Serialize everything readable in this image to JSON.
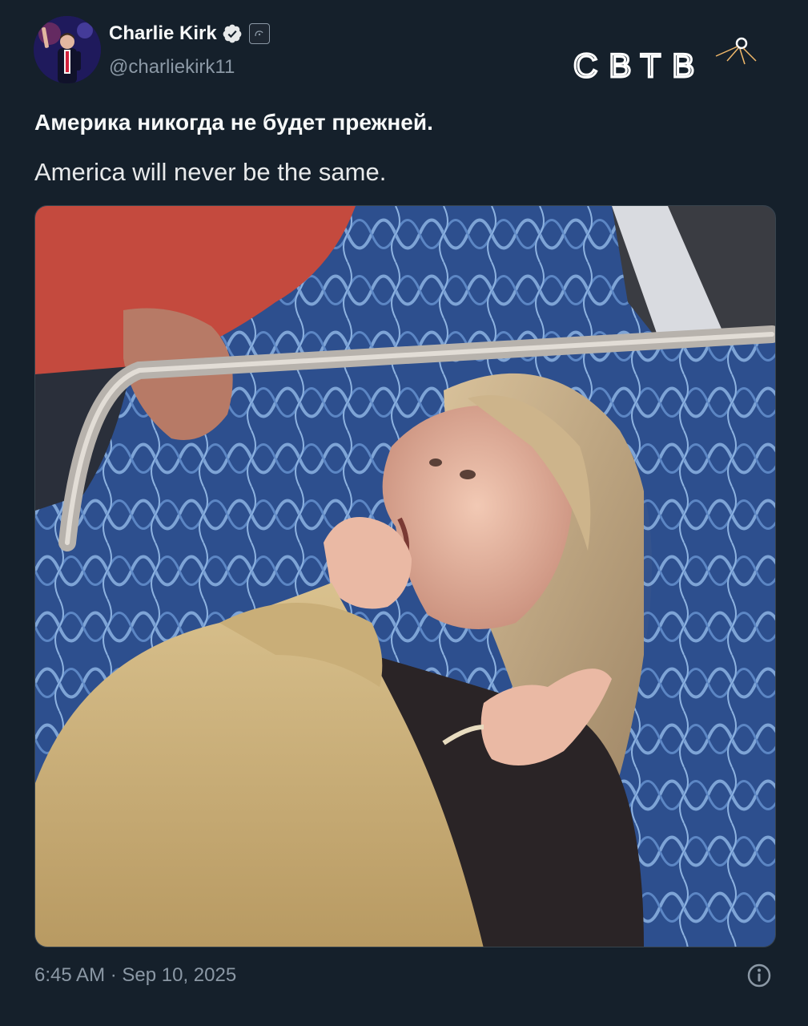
{
  "author": {
    "name": "Charlie Kirk",
    "handle": "@charliekirk11",
    "verified": true,
    "avatar_icon": "profile-photo"
  },
  "watermark": {
    "text": "СВТВ",
    "icon": "sputnik-icon",
    "color": "#ffffff"
  },
  "tweet": {
    "text_original": "Америка никогда не будет прежней.",
    "text_translation": "America will never be the same.",
    "media_alt": "photo-woman-on-train",
    "timestamp": "6:45 AM · Sep 10, 2025"
  },
  "colors": {
    "background": "#15202b",
    "verified": "#1d9bf0",
    "secondary_text": "#8b98a5"
  }
}
